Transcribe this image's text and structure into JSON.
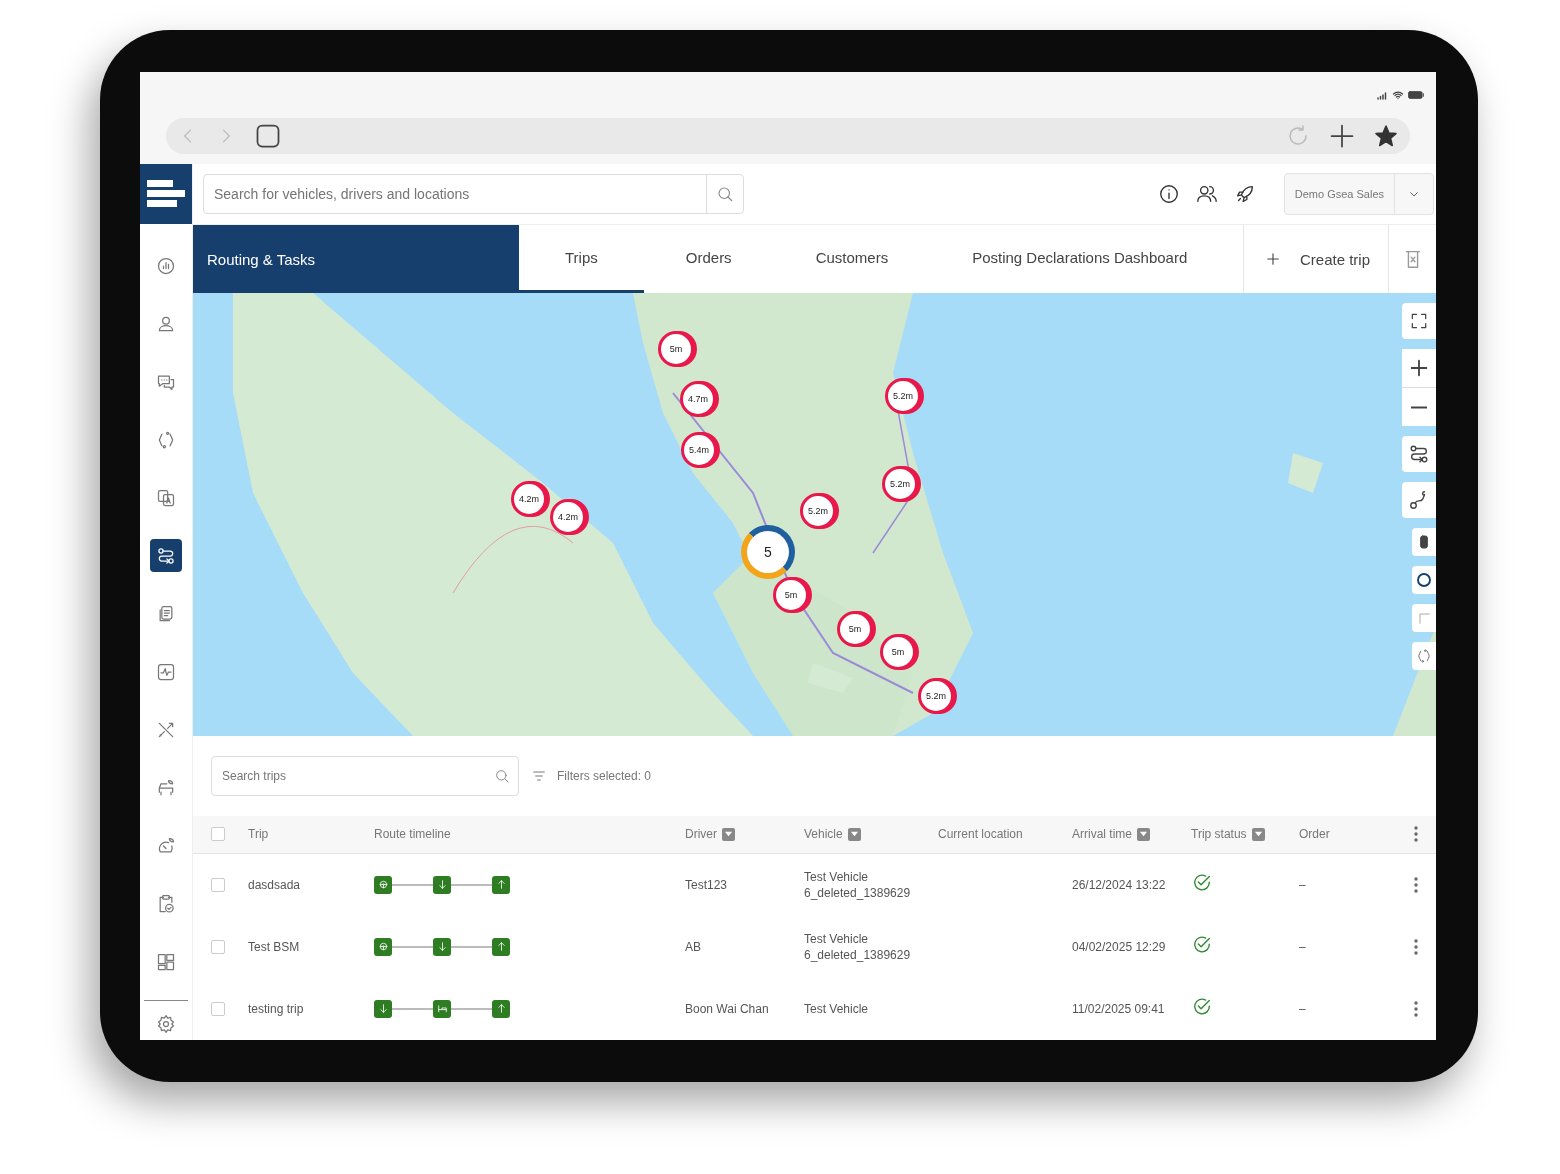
{
  "header": {
    "search": {
      "placeholder": "Search for vehicles, drivers and locations"
    },
    "account": "Demo Gsea Sales"
  },
  "sidebar": {
    "items": [
      {
        "kind": "chart",
        "selected": false
      },
      {
        "kind": "user",
        "selected": false
      },
      {
        "kind": "chat",
        "selected": false
      },
      {
        "kind": "cycle",
        "selected": false
      },
      {
        "kind": "translate",
        "selected": false
      },
      {
        "kind": "routing",
        "selected": true
      },
      {
        "kind": "documents",
        "selected": false
      },
      {
        "kind": "activity",
        "selected": false
      },
      {
        "kind": "tools",
        "selected": false
      },
      {
        "kind": "car-leaf",
        "selected": false
      },
      {
        "kind": "gauge-leaf",
        "selected": false
      },
      {
        "kind": "clipboard-check",
        "selected": false
      },
      {
        "kind": "grid",
        "selected": false
      },
      {
        "kind": "settings",
        "selected": false
      }
    ]
  },
  "section_title": "Routing & Tasks",
  "tabs": [
    {
      "label": "Trips",
      "selected": true
    },
    {
      "label": "Orders",
      "selected": false
    },
    {
      "label": "Customers",
      "selected": false
    },
    {
      "label": "Posting Declarations Dashboard",
      "selected": false
    }
  ],
  "create_button": "Create trip",
  "map": {
    "kind": "picture",
    "markers": [
      {
        "label": "5m"
      },
      {
        "label": "4.7m"
      },
      {
        "label": "5.4m"
      },
      {
        "label": "4.2m"
      },
      {
        "label": "4.2m"
      },
      {
        "label": "5.2m"
      },
      {
        "label": "5.2m"
      },
      {
        "label": "5.2m"
      },
      {
        "label": "5m"
      },
      {
        "label": "5m"
      },
      {
        "label": "5m"
      },
      {
        "label": "5.2m"
      }
    ],
    "cluster": "5"
  },
  "trips_search": {
    "placeholder": "Search trips"
  },
  "filters": "Filters selected: 0",
  "select_all": {
    "checked": false
  },
  "table": {
    "columns": [
      {
        "label": "Trip",
        "filterable": false
      },
      {
        "label": "Route timeline",
        "filterable": false
      },
      {
        "label": "Driver",
        "filterable": true
      },
      {
        "label": "Vehicle",
        "filterable": true
      },
      {
        "label": "Current location",
        "filterable": false
      },
      {
        "label": "Arrival time",
        "filterable": true
      },
      {
        "label": "Trip status",
        "filterable": true
      },
      {
        "label": "Order",
        "filterable": false
      }
    ],
    "rows": [
      {
        "trip": "dasdsada",
        "stops": [
          {
            "kind": "start"
          },
          {
            "kind": "drop"
          },
          {
            "kind": "pickup"
          }
        ],
        "driver": "Test123",
        "vehicle": "Test Vehicle\n6_deleted_1389629",
        "arrival": "26/12/2024 13:22",
        "status": {
          "kind": "completed"
        },
        "order": "–",
        "checked": false
      },
      {
        "trip": "Test BSM",
        "stops": [
          {
            "kind": "start"
          },
          {
            "kind": "drop"
          },
          {
            "kind": "pickup"
          }
        ],
        "driver": "AB",
        "vehicle": "Test Vehicle\n6_deleted_1389629",
        "arrival": "04/02/2025 12:29",
        "status": {
          "kind": "completed"
        },
        "order": "–",
        "checked": false
      },
      {
        "trip": "testing trip",
        "stops": [
          {
            "kind": "drop"
          },
          {
            "kind": "rest"
          },
          {
            "kind": "pickup"
          }
        ],
        "driver": "Boon Wai Chan",
        "vehicle": "Test Vehicle",
        "arrival": "11/02/2025 09:41",
        "status": {
          "kind": "completed"
        },
        "order": "–",
        "checked": false
      }
    ]
  }
}
